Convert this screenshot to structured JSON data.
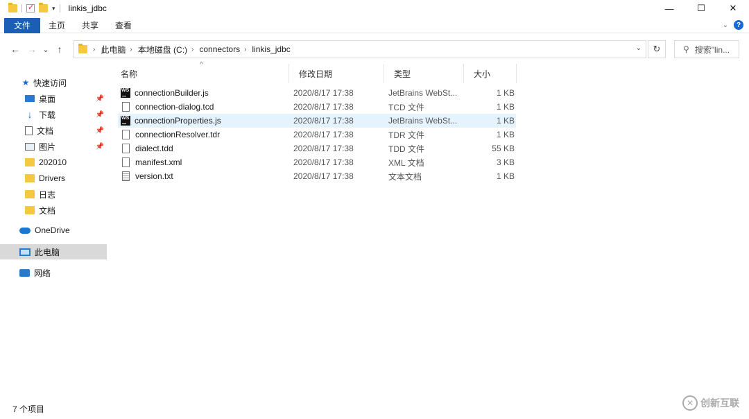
{
  "window": {
    "title": "linkis_jdbc",
    "controls": {
      "minimize": "—",
      "maximize": "☐",
      "close": "✕"
    }
  },
  "ribbon": {
    "tabs": [
      "文件",
      "主页",
      "共享",
      "查看"
    ],
    "help": "?"
  },
  "nav": {
    "back": "←",
    "forward": "→",
    "recent": "⌄",
    "up": "↑",
    "breadcrumb": [
      "此电脑",
      "本地磁盘 (C:)",
      "connectors",
      "linkis_jdbc"
    ],
    "refresh": "↻",
    "search_placeholder": "搜索\"lin..."
  },
  "sidebar": {
    "items": [
      {
        "label": "快速访问",
        "icon": "star-icon"
      },
      {
        "label": "桌面",
        "icon": "desktop-icon",
        "pinned": true
      },
      {
        "label": "下载",
        "icon": "download-icon",
        "pinned": true
      },
      {
        "label": "文档",
        "icon": "document-icon",
        "pinned": true
      },
      {
        "label": "图片",
        "icon": "picture-icon",
        "pinned": true
      },
      {
        "label": "202010",
        "icon": "folder-icon"
      },
      {
        "label": "Drivers",
        "icon": "folder-icon"
      },
      {
        "label": "日志",
        "icon": "folder-icon"
      },
      {
        "label": "文档",
        "icon": "folder-icon"
      },
      {
        "label": "OneDrive",
        "icon": "cloud-icon"
      },
      {
        "label": "此电脑",
        "icon": "computer-icon",
        "selected": true
      },
      {
        "label": "网络",
        "icon": "network-icon"
      }
    ]
  },
  "columns": {
    "name": "名称",
    "date": "修改日期",
    "type": "类型",
    "size": "大小"
  },
  "files": [
    {
      "name": "connectionBuilder.js",
      "date": "2020/8/17 17:38",
      "type": "JetBrains WebSt...",
      "size": "1 KB",
      "icon": "webstorm-icon"
    },
    {
      "name": "connection-dialog.tcd",
      "date": "2020/8/17 17:38",
      "type": "TCD 文件",
      "size": "1 KB",
      "icon": "file-icon"
    },
    {
      "name": "connectionProperties.js",
      "date": "2020/8/17 17:38",
      "type": "JetBrains WebSt...",
      "size": "1 KB",
      "icon": "webstorm-icon"
    },
    {
      "name": "connectionResolver.tdr",
      "date": "2020/8/17 17:38",
      "type": "TDR 文件",
      "size": "1 KB",
      "icon": "file-icon"
    },
    {
      "name": "dialect.tdd",
      "date": "2020/8/17 17:38",
      "type": "TDD 文件",
      "size": "55 KB",
      "icon": "file-icon"
    },
    {
      "name": "manifest.xml",
      "date": "2020/8/17 17:38",
      "type": "XML 文档",
      "size": "3 KB",
      "icon": "file-icon"
    },
    {
      "name": "version.txt",
      "date": "2020/8/17 17:38",
      "type": "文本文档",
      "size": "1 KB",
      "icon": "text-file-icon"
    }
  ],
  "status": {
    "count": "7 个项目"
  },
  "watermark": {
    "text": "创新互联"
  }
}
